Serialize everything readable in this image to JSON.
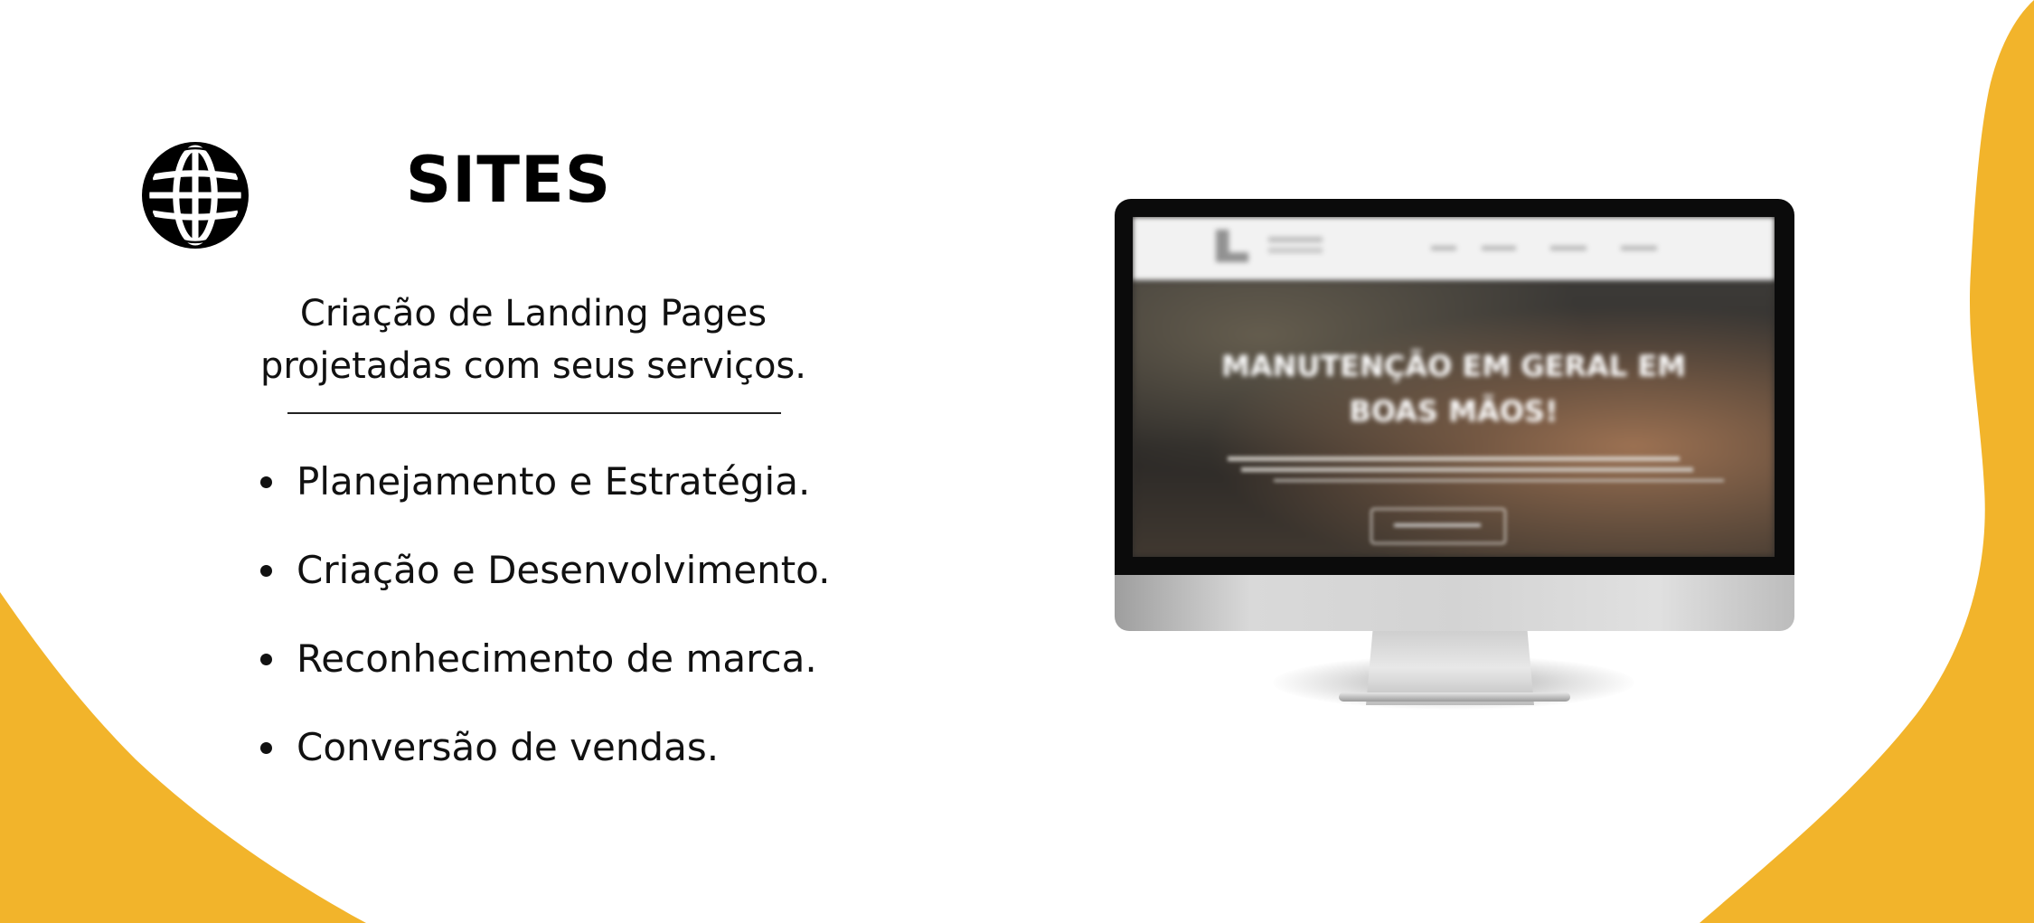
{
  "colors": {
    "accent": "#F2B42B",
    "background": "#FFFFFF",
    "text": "#111111"
  },
  "icon": "globe-icon",
  "header": {
    "title": "SITES"
  },
  "intro": {
    "line1": "Criação de Landing Pages",
    "line2": "projetadas com seus serviços."
  },
  "features": [
    "Planejamento e Estratégia.",
    "Criação e Desenvolvimento.",
    "Reconhecimento de marca.",
    "Conversão de vendas."
  ],
  "mockup": {
    "hero_title_line1": "MANUTENÇÃO EM GERAL EM",
    "hero_title_line2": "BOAS MÃOS!"
  }
}
